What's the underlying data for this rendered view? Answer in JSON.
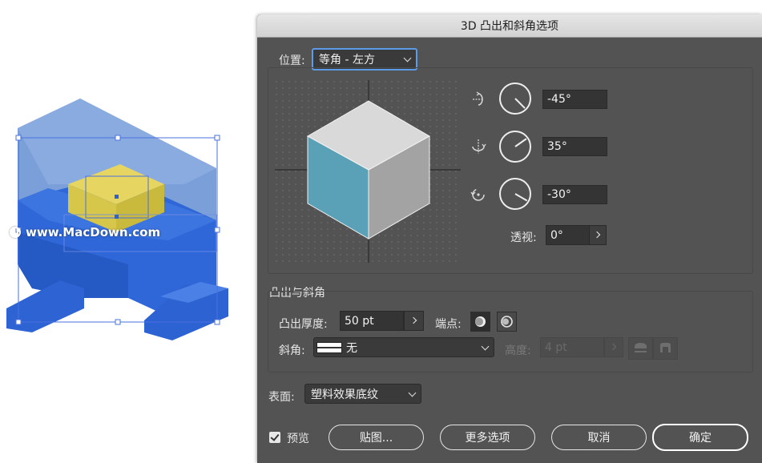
{
  "canvas": {
    "watermark": "www.MacDown.com"
  },
  "dialog": {
    "title": "3D 凸出和斜角选项",
    "position": {
      "label": "位置:",
      "selected": "等角 - 左方"
    },
    "rotation": {
      "x": "-45°",
      "y": "35°",
      "z": "-30°"
    },
    "perspective": {
      "label": "透视:",
      "value": "0°"
    },
    "extrude": {
      "section_title": "凸出与斜角",
      "depth_label": "凸出厚度:",
      "depth_value": "50 pt",
      "cap_label": "端点:",
      "bevel_label": "斜角:",
      "bevel_value": "无",
      "height_label": "高度:",
      "height_value": "4 pt"
    },
    "surface": {
      "label": "表面:",
      "selected": "塑料效果底纹"
    },
    "footer": {
      "preview_label": "预览",
      "map_button": "贴图...",
      "more_button": "更多选项",
      "cancel_button": "取消",
      "ok_button": "确定"
    },
    "colors": {
      "cube_top": "#d9d9d9",
      "cube_left": "#5aa0b6",
      "cube_right": "#a3a3a3",
      "focus": "#5d9be8"
    }
  }
}
